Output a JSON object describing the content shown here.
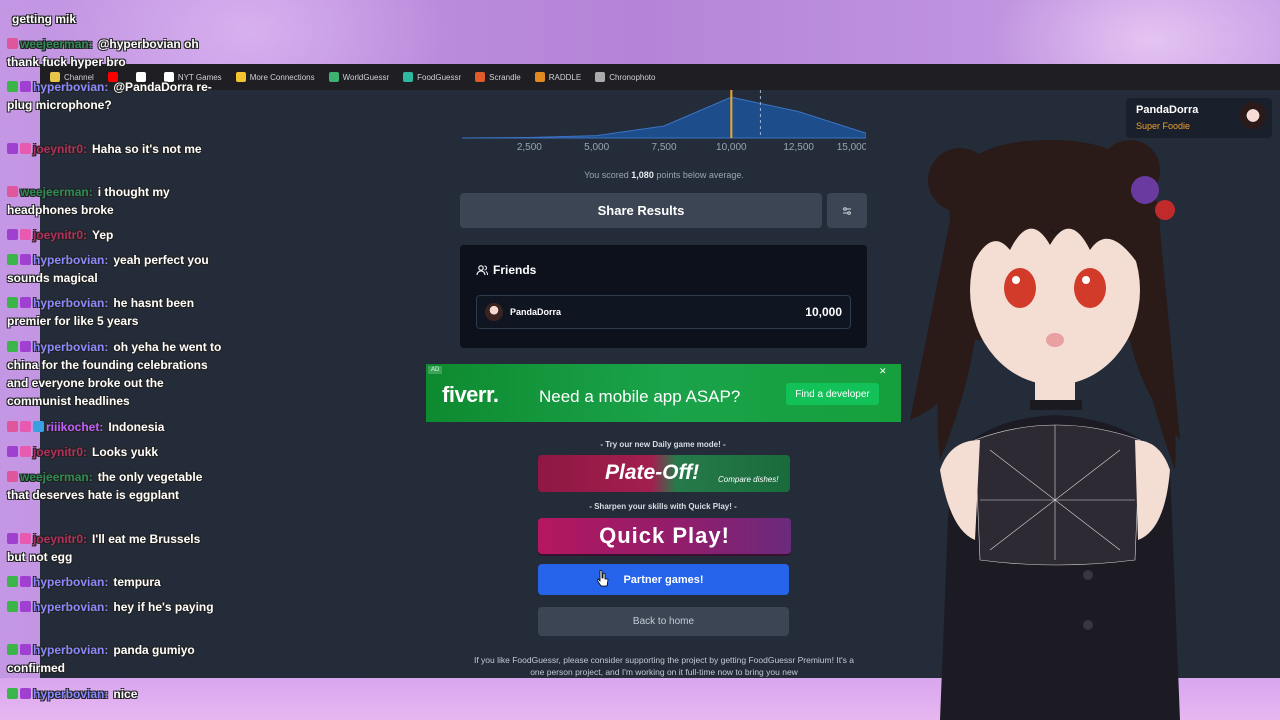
{
  "bookmarks": [
    {
      "label": "Channel",
      "icon": "folder-icon"
    },
    {
      "label": "",
      "icon": "youtube-icon"
    },
    {
      "label": "",
      "icon": "x-icon"
    },
    {
      "label": "NYT Games",
      "icon": "nyt-icon"
    },
    {
      "label": "More Connections",
      "icon": "grid-icon"
    },
    {
      "label": "WorldGuessr",
      "icon": "globe-icon"
    },
    {
      "label": "FoodGuessr",
      "icon": "food-icon"
    },
    {
      "label": "Scrandle",
      "icon": "scrandle-icon"
    },
    {
      "label": "RADDLE",
      "icon": "raddle-icon"
    },
    {
      "label": "Chronophoto",
      "icon": "camera-icon"
    }
  ],
  "chart_data": {
    "type": "area",
    "x_ticks": [
      "2,500",
      "5,000",
      "7,500",
      "10,000",
      "12,500",
      "15,000"
    ],
    "xlim": [
      0,
      15000
    ],
    "user_score": 10000,
    "average_score": 11080,
    "series": [
      {
        "x": [
          0,
          2500,
          5000,
          7500,
          10000,
          12500,
          15000
        ],
        "values": [
          0,
          0.01,
          0.05,
          0.25,
          0.85,
          0.55,
          0.1
        ]
      }
    ]
  },
  "score_note": {
    "prefix": "You scored",
    "value": "1,080",
    "suffix": "points below average."
  },
  "share_label": "Share Results",
  "friends": {
    "title": "Friends",
    "rows": [
      {
        "name": "PandaDorra",
        "score": "10,000"
      }
    ]
  },
  "ad": {
    "tag": "AD",
    "logo": "fiverr.",
    "text": "Need a mobile app ASAP?",
    "button": "Find a developer",
    "close": "✕"
  },
  "daily_caption": "- Try our new Daily game mode! -",
  "plateoff": {
    "title": "Plate-Off!",
    "subtitle": "Compare dishes!"
  },
  "quick_caption": "- Sharpen your skills with Quick Play! -",
  "quick_play": "Quick Play!",
  "partner": "Partner games!",
  "back_home": "Back to home",
  "support_text": "If you like FoodGuessr, please consider supporting the project by getting FoodGuessr Premium! It's a one person project, and I'm working on it full-time now to bring you new",
  "profile": {
    "name": "PandaDorra",
    "title": "Super Foodie"
  },
  "chat": [
    {
      "user": "",
      "text": "getting mik",
      "color": "#ffffff",
      "badges": []
    },
    {
      "user": "weejeerman:",
      "text": "@hyperbovian oh thank fuck hyper bro",
      "color": "#2e8b57",
      "badges": [
        "heart"
      ]
    },
    {
      "user": "hyperbovian:",
      "text": "@PandaDorra re-plug microphone?",
      "color": "#8a8aff",
      "badges": [
        "check",
        "one"
      ]
    },
    {
      "user": "joeynitr0:",
      "text": "Haha so it's not me",
      "color": "#b03060",
      "badges": [
        "one",
        "star"
      ]
    },
    {
      "user": "weejeerman:",
      "text": "i thought my headphones broke",
      "color": "#2e8b57",
      "badges": [
        "heart"
      ]
    },
    {
      "user": "joeynitr0:",
      "text": "Yep",
      "color": "#b03060",
      "badges": [
        "one",
        "star"
      ]
    },
    {
      "user": "hyperbovian:",
      "text": "yeah perfect you sounds magical",
      "color": "#8a8aff",
      "badges": [
        "check",
        "one"
      ]
    },
    {
      "user": "hyperbovian:",
      "text": "he hasnt been premier for like 5 years",
      "color": "#8a8aff",
      "badges": [
        "check",
        "one"
      ]
    },
    {
      "user": "hyperbovian:",
      "text": "oh yeha he went to china for the founding celebrations and everyone broke out the communist headlines",
      "color": "#8a8aff",
      "badges": [
        "check",
        "one"
      ]
    },
    {
      "user": "riiikochet:",
      "text": "Indonesia",
      "color": "#c060ff",
      "badges": [
        "heart",
        "star",
        "blue"
      ]
    },
    {
      "user": "joeynitr0:",
      "text": "Looks yukk",
      "color": "#b03060",
      "badges": [
        "one",
        "star"
      ]
    },
    {
      "user": "weejeerman:",
      "text": "the only vegetable that deserves hate is eggplant",
      "color": "#2e8b57",
      "badges": [
        "heart"
      ]
    },
    {
      "user": "joeynitr0:",
      "text": "I'll eat me Brussels but not egg",
      "color": "#b03060",
      "badges": [
        "one",
        "star"
      ]
    },
    {
      "user": "hyperbovian:",
      "text": "tempura",
      "color": "#8a8aff",
      "badges": [
        "check",
        "one"
      ]
    },
    {
      "user": "hyperbovian:",
      "text": "hey if he's paying",
      "color": "#8a8aff",
      "badges": [
        "check",
        "one"
      ]
    },
    {
      "user": "hyperbovian:",
      "text": "panda gumiyo confirmed",
      "color": "#8a8aff",
      "badges": [
        "check",
        "one"
      ]
    },
    {
      "user": "hyperbovian:",
      "text": "nice",
      "color": "#8a8aff",
      "badges": [
        "check",
        "one"
      ]
    }
  ]
}
